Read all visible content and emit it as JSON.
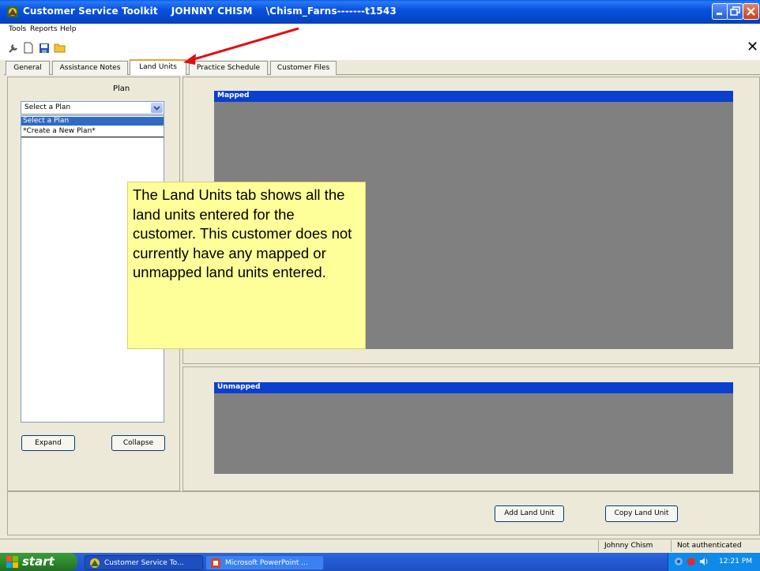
{
  "window": {
    "title": "Customer Service Toolkit    JOHNNY CHISM    \\Chism_Farns-------t1543"
  },
  "menu": [
    "Tools",
    "Reports",
    "Help"
  ],
  "toolbar": {
    "close_glyph": "✕"
  },
  "tabs": [
    {
      "label": "General",
      "active": false
    },
    {
      "label": "Assistance Notes",
      "active": false
    },
    {
      "label": "Land Units",
      "active": true
    },
    {
      "label": "Practice Schedule",
      "active": false
    },
    {
      "label": "Customer Files",
      "active": false
    }
  ],
  "plan": {
    "heading": "Plan",
    "select_value": "Select a Plan",
    "options": [
      "Select a Plan",
      "*Create a New Plan*"
    ],
    "expand_label": "Expand",
    "collapse_label": "Collapse"
  },
  "mapped": {
    "header": "Mapped"
  },
  "unmapped": {
    "header": "Unmapped"
  },
  "callout": {
    "text": "The Land Units tab shows all the land units entered for the customer. This customer does not currently have any mapped or unmapped land units entered."
  },
  "actions": {
    "add_label": "Add Land Unit",
    "copy_label": "Copy Land Unit"
  },
  "status": {
    "user": "Johnny Chism",
    "auth": "Not authenticated"
  },
  "taskbar": {
    "start_label": "start",
    "tasks": [
      "Customer Service To...",
      "Microsoft PowerPoint ..."
    ],
    "clock": "12:21 PM"
  },
  "colors": {
    "header_blue": "#0a3fd0",
    "gray_area": "#808080",
    "callout_bg": "#ffff99",
    "arrow_red": "#e01010"
  }
}
